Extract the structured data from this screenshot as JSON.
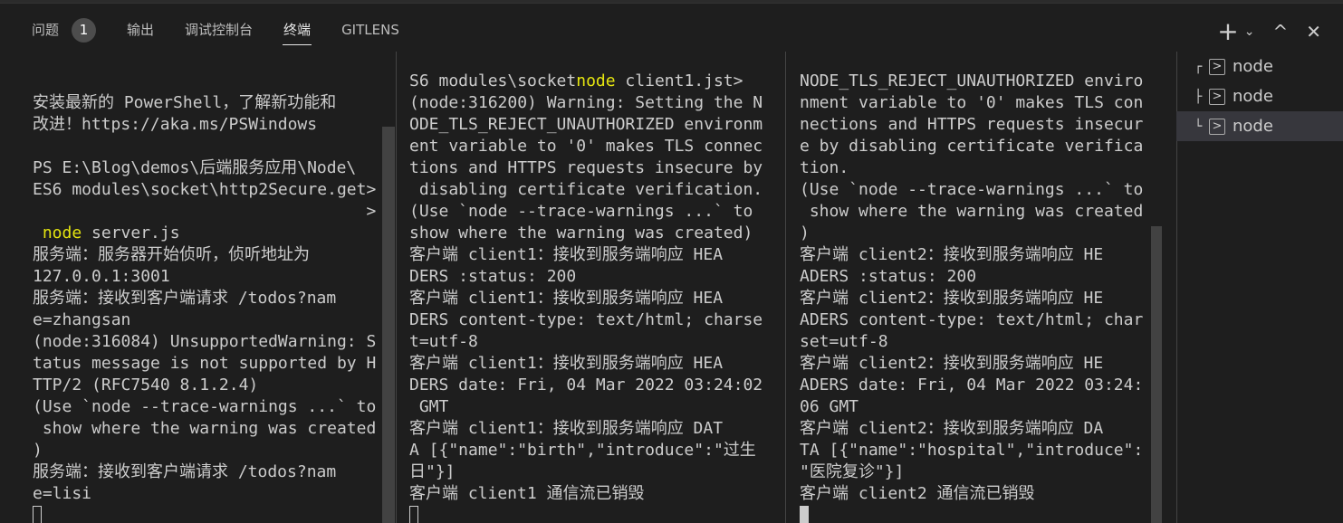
{
  "tabs": [
    {
      "label": "问题",
      "badge": "1"
    },
    {
      "label": "输出"
    },
    {
      "label": "调试控制台"
    },
    {
      "label": "终端",
      "active": true
    },
    {
      "label": "GITLENS"
    }
  ],
  "actions": {
    "add": "+",
    "dropdown": "⌄",
    "maximize": "^",
    "close": "✕"
  },
  "terminals": [
    {
      "label": "node",
      "tree": "┌"
    },
    {
      "label": "node",
      "tree": "├"
    },
    {
      "label": "node",
      "tree": "└",
      "selected": true
    }
  ],
  "panes": [
    {
      "lines": [
        "安装最新的 PowerShell，了解新功能和",
        "改进！https://aka.ms/PSWindows",
        "",
        "PS E:\\Blog\\demos\\后端服务应用\\Node\\",
        "ES6 modules\\socket\\http2Secure.get>",
        "                                  >",
        {
          "pre": " ",
          "hl": "node",
          "post": " server.js"
        },
        "服务端：服务器开始侦听，侦听地址为",
        "127.0.0.1:3001",
        "服务端：接收到客户端请求 /todos?nam",
        "e=zhangsan",
        "(node:316084) UnsupportedWarning: S",
        "tatus message is not supported by H",
        "TTP/2 (RFC7540 8.1.2.4)",
        "(Use `node --trace-warnings ...` to",
        " show where the warning was created",
        ")",
        "服务端：接收到客户端请求 /todos?nam",
        "e=lisi"
      ]
    },
    {
      "lines": [
        {
          "pre": "S6 modules\\socket",
          "hl": "node",
          "post": " client1.jst>"
        },
        "(node:316200) Warning: Setting the N",
        "ODE_TLS_REJECT_UNAUTHORIZED environm",
        "ent variable to '0' makes TLS connec",
        "tions and HTTPS requests insecure by",
        " disabling certificate verification.",
        "(Use `node --trace-warnings ...` to",
        "show where the warning was created)",
        "客户端 client1：接收到服务端响应 HEA",
        "DERS :status: 200",
        "客户端 client1：接收到服务端响应 HEA",
        "DERS content-type: text/html; charse",
        "t=utf-8",
        "客户端 client1：接收到服务端响应 HEA",
        "DERS date: Fri, 04 Mar 2022 03:24:02",
        " GMT",
        "客户端 client1：接收到服务端响应 DAT",
        "A [{\"name\":\"birth\",\"introduce\":\"过生",
        "日\"}]",
        "客户端 client1 通信流已销毁"
      ]
    },
    {
      "lines": [
        "NODE_TLS_REJECT_UNAUTHORIZED enviro",
        "nment variable to '0' makes TLS con",
        "nections and HTTPS requests insecur",
        "e by disabling certificate verifica",
        "tion.",
        "(Use `node --trace-warnings ...` to",
        " show where the warning was created",
        ")",
        "客户端 client2：接收到服务端响应 HE",
        "ADERS :status: 200",
        "客户端 client2：接收到服务端响应 HE",
        "ADERS content-type: text/html; char",
        "set=utf-8",
        "客户端 client2：接收到服务端响应 HE",
        "ADERS date: Fri, 04 Mar 2022 03:24:",
        "06 GMT",
        "客户端 client2：接收到服务端响应 DA",
        "TA [{\"name\":\"hospital\",\"introduce\":",
        "\"医院复诊\"}]",
        "客户端 client2 通信流已销毁"
      ]
    }
  ]
}
